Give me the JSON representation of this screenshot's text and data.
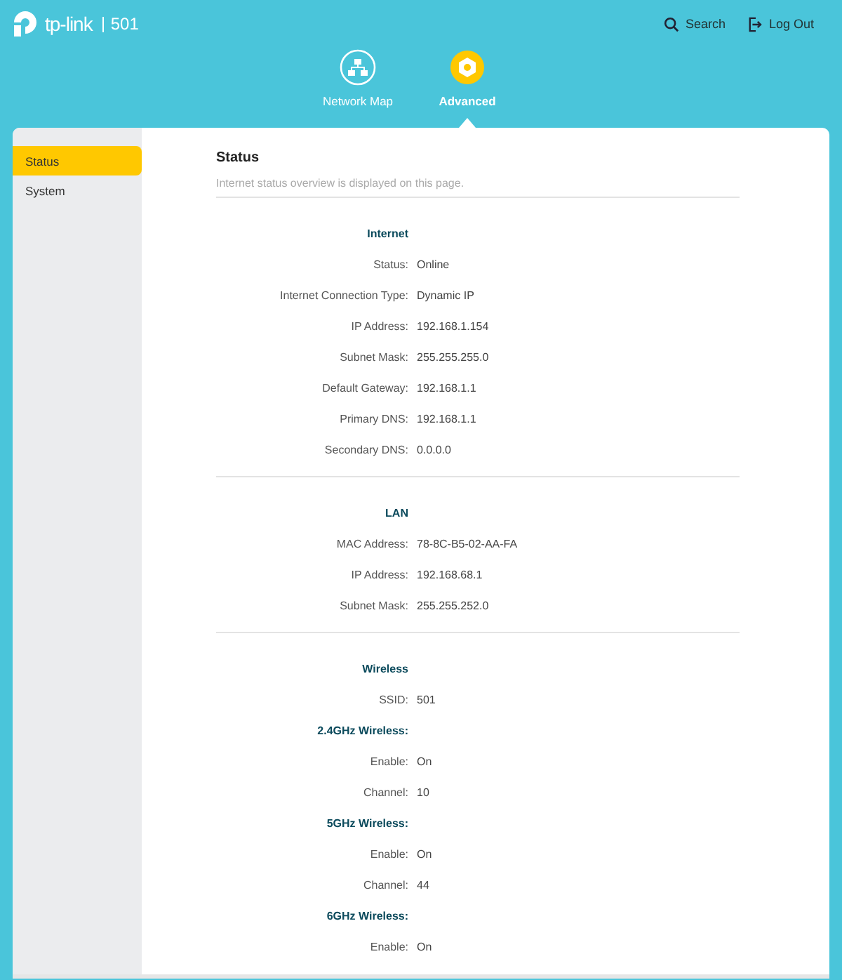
{
  "header": {
    "brand": "tp-link",
    "model": "501",
    "actions": [
      {
        "kind": "search",
        "label": "Search"
      },
      {
        "kind": "logout",
        "label": "Log Out"
      }
    ]
  },
  "nav_tabs": [
    {
      "kind": "map",
      "label": "Network Map",
      "selected": false
    },
    {
      "kind": "advanced",
      "label": "Advanced",
      "selected": true
    }
  ],
  "sidebar": {
    "items": [
      {
        "label": "Status",
        "selected": true
      },
      {
        "label": "System",
        "selected": false
      }
    ]
  },
  "page": {
    "title": "Status",
    "description": "Internet status overview is displayed on this page."
  },
  "sections": [
    {
      "rows": [
        {
          "kind": "heading",
          "label": "Internet"
        },
        {
          "kind": "field",
          "label": "Status:",
          "value": "Online"
        },
        {
          "kind": "field",
          "label": "Internet Connection Type:",
          "value": "Dynamic IP"
        },
        {
          "kind": "field",
          "label": "IP Address:",
          "value": "192.168.1.154"
        },
        {
          "kind": "field",
          "label": "Subnet Mask:",
          "value": "255.255.255.0"
        },
        {
          "kind": "field",
          "label": "Default Gateway:",
          "value": "192.168.1.1"
        },
        {
          "kind": "field",
          "label": "Primary DNS:",
          "value": "192.168.1.1"
        },
        {
          "kind": "field",
          "label": "Secondary DNS:",
          "value": "0.0.0.0"
        }
      ]
    },
    {
      "rows": [
        {
          "kind": "heading",
          "label": "LAN"
        },
        {
          "kind": "field",
          "label": "MAC Address:",
          "value": "78-8C-B5-02-AA-FA"
        },
        {
          "kind": "field",
          "label": "IP Address:",
          "value": "192.168.68.1"
        },
        {
          "kind": "field",
          "label": "Subnet Mask:",
          "value": "255.255.252.0"
        }
      ]
    },
    {
      "rows": [
        {
          "kind": "heading",
          "label": "Wireless"
        },
        {
          "kind": "field",
          "label": "SSID:",
          "value": "501"
        },
        {
          "kind": "subheading",
          "label": "2.4GHz Wireless:"
        },
        {
          "kind": "field",
          "label": "Enable:",
          "value": "On"
        },
        {
          "kind": "field",
          "label": "Channel:",
          "value": "10"
        },
        {
          "kind": "subheading",
          "label": "5GHz Wireless:"
        },
        {
          "kind": "field",
          "label": "Enable:",
          "value": "On"
        },
        {
          "kind": "field",
          "label": "Channel:",
          "value": "44"
        },
        {
          "kind": "subheading",
          "label": "6GHz Wireless:"
        },
        {
          "kind": "field",
          "label": "Enable:",
          "value": "On"
        }
      ]
    }
  ]
}
